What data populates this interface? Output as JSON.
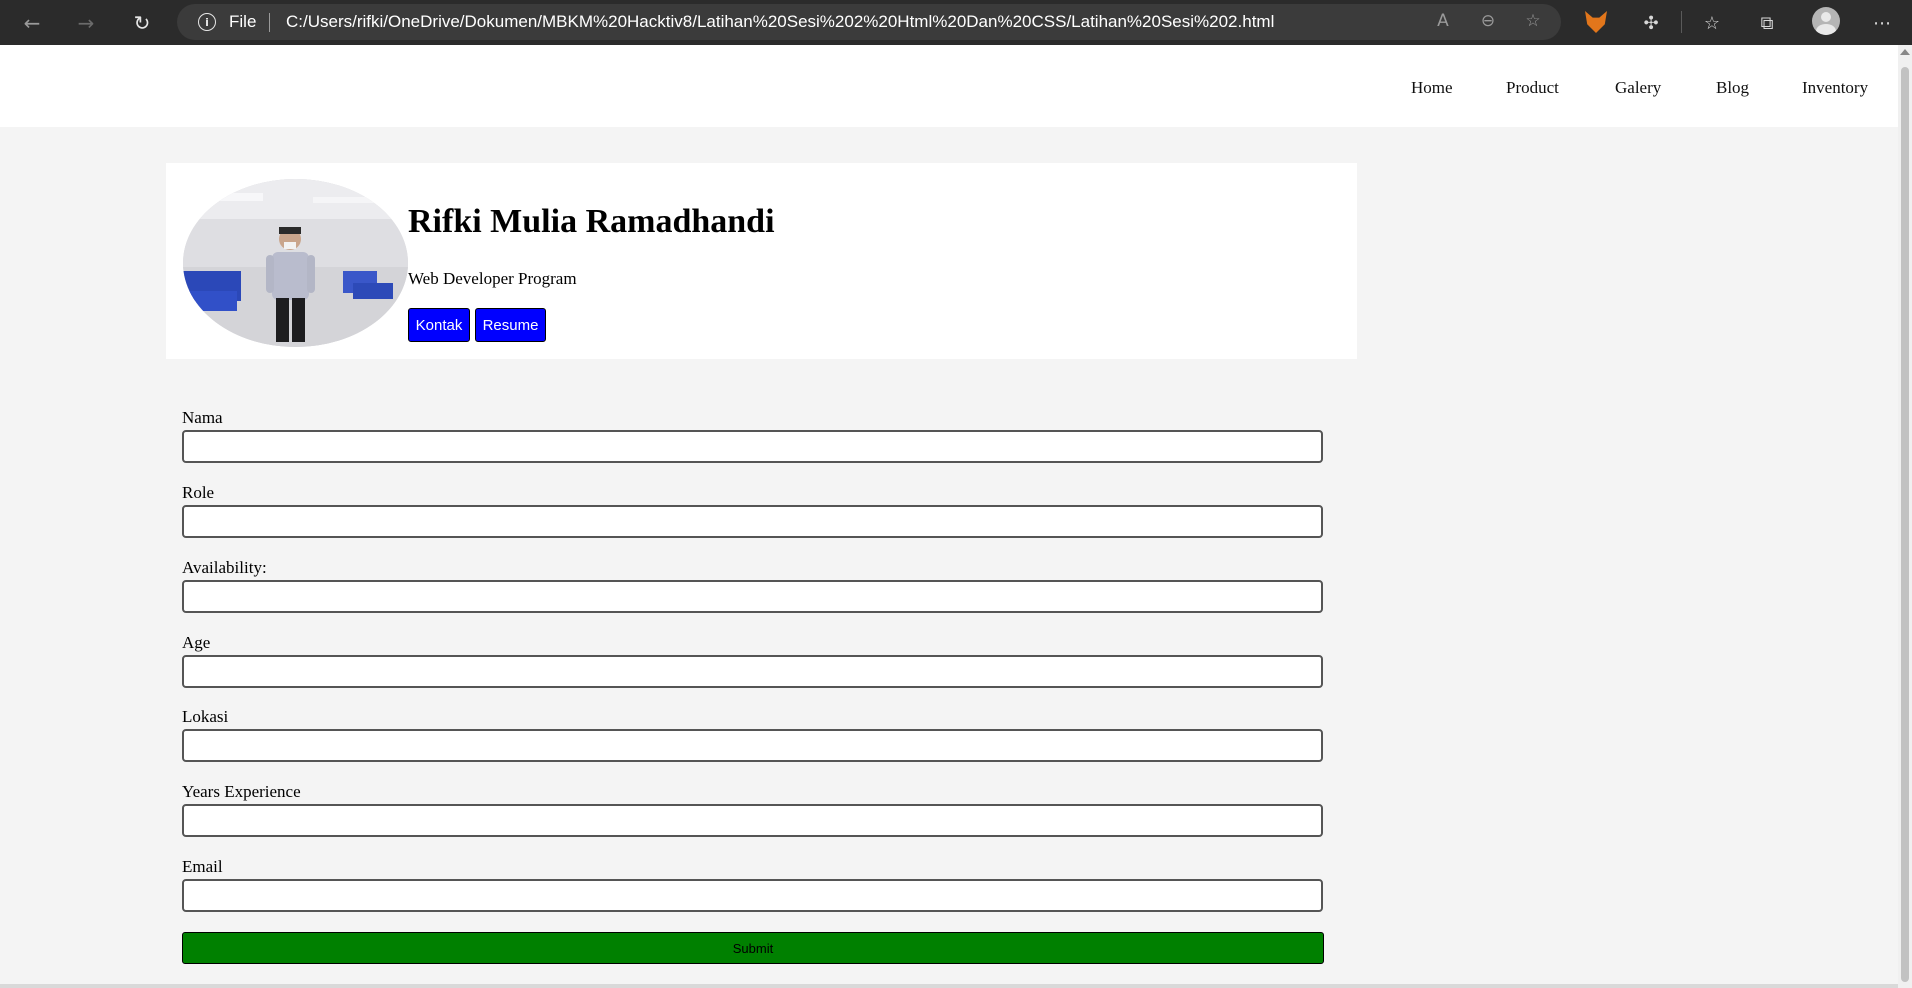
{
  "browser": {
    "address_prefix": "File",
    "url": "C:/Users/rifki/OneDrive/Dokumen/MBKM%20Hacktiv8/Latihan%20Sesi%202%20Html%20Dan%20CSS/Latihan%20Sesi%202.html",
    "icons": {
      "back": "back-arrow-icon",
      "forward": "forward-arrow-icon",
      "reload": "reload-icon",
      "info": "info-icon",
      "read_aloud": "read-aloud-icon",
      "zoom": "zoom-out-icon",
      "favorite": "add-favorite-icon",
      "metamask": "metamask-fox-icon",
      "extensions": "extensions-puzzle-icon",
      "favorites": "favorites-icon",
      "collections": "collections-icon",
      "profile": "profile-avatar-icon",
      "menu": "more-menu-icon"
    }
  },
  "nav": {
    "links": [
      "Home",
      "Product",
      "Galery",
      "Blog",
      "Inventory"
    ]
  },
  "profile": {
    "name": "Rifki Mulia Ramadhandi",
    "role": "Web Developer Program",
    "buttons": [
      "Kontak",
      "Resume"
    ],
    "button_color": "#0000ff"
  },
  "form": {
    "fields": [
      {
        "label": "Nama",
        "value": ""
      },
      {
        "label": "Role",
        "value": ""
      },
      {
        "label": "Availability:",
        "value": ""
      },
      {
        "label": "Age",
        "value": ""
      },
      {
        "label": "Lokasi",
        "value": ""
      },
      {
        "label": "Years Experience",
        "value": ""
      },
      {
        "label": "Email",
        "value": ""
      }
    ],
    "submit_label": "Submit",
    "submit_color": "#008000"
  }
}
